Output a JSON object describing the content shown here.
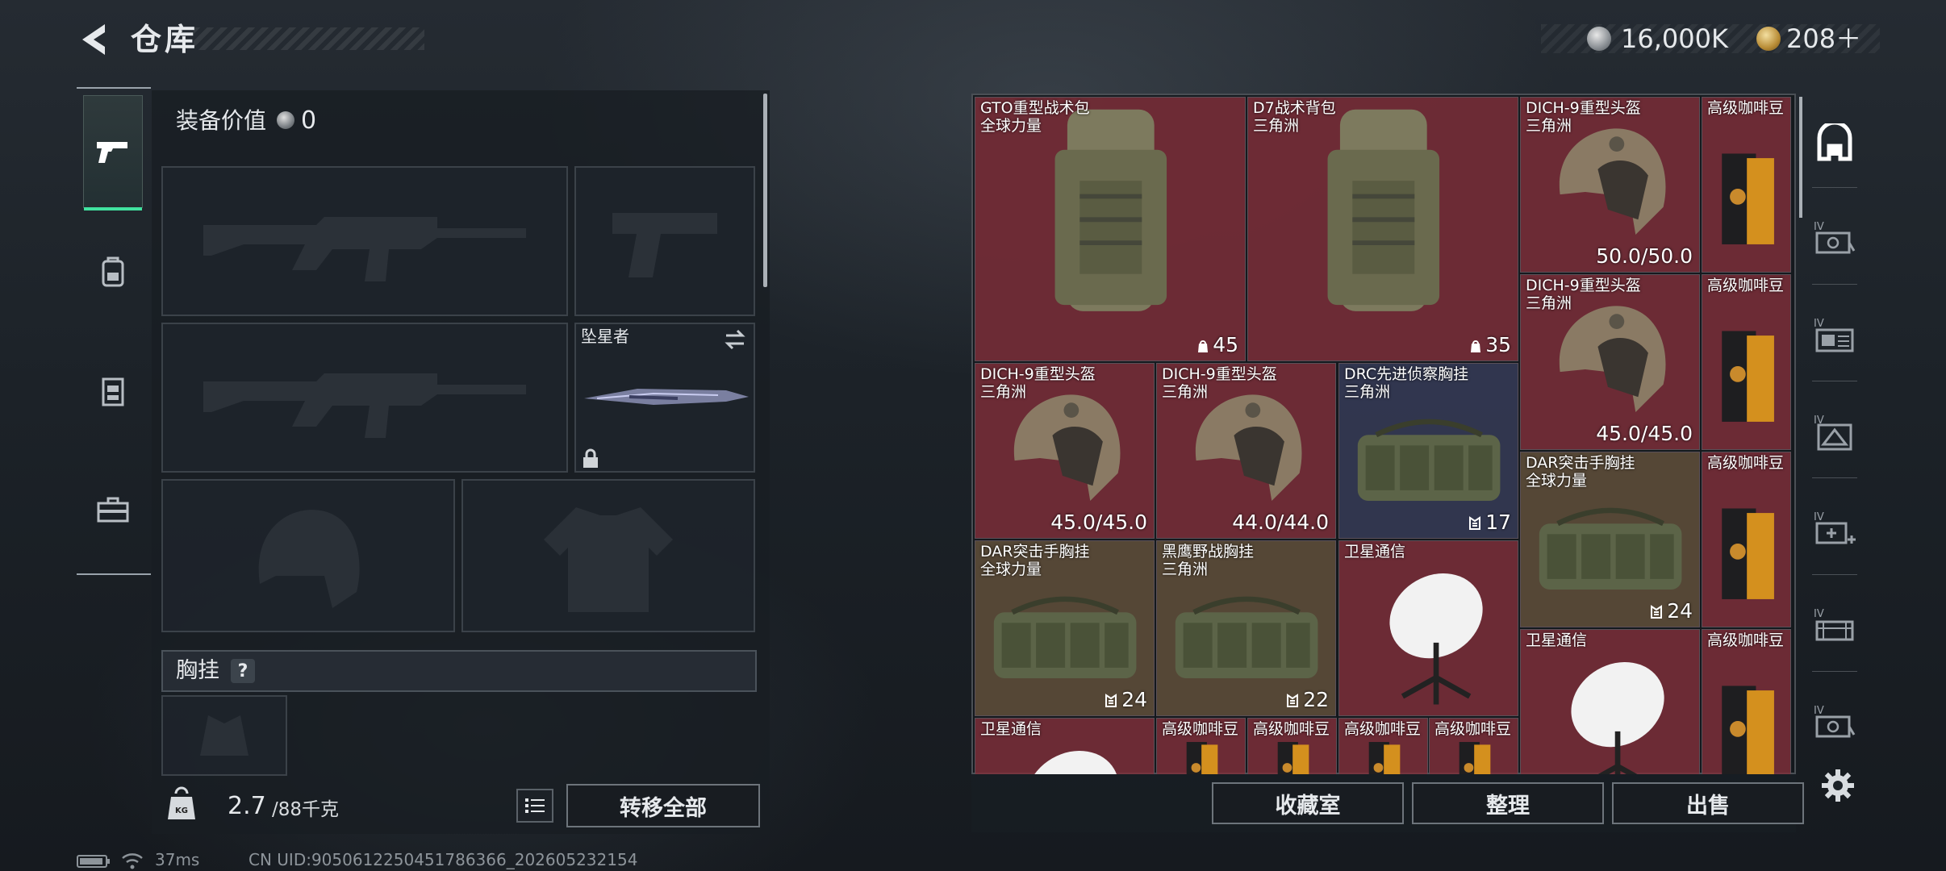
{
  "header": {
    "title": "仓库",
    "money": "16,000K",
    "premium": "208＋"
  },
  "equipment": {
    "value_label": "装备价值",
    "value": "0",
    "melee": {
      "name": "坠星者"
    },
    "rig": {
      "label": "胸挂",
      "help": "?"
    },
    "weight": {
      "current": "2.7",
      "capacity": "/88千克"
    },
    "transfer_all": "转移全部"
  },
  "status": {
    "ping": "37ms",
    "uid": "CN UID:9050612250451786366_202605232154"
  },
  "stash": {
    "items": [
      {
        "name": "GTO重型战术包",
        "sub": "全球力量",
        "stat": "45",
        "stat_icon": "capacity-icon",
        "rarity": "red",
        "kind": "backpack"
      },
      {
        "name": "D7战术背包",
        "sub": "三角洲",
        "stat": "35",
        "stat_icon": "capacity-icon",
        "rarity": "red",
        "kind": "backpack"
      },
      {
        "name": "DICH-9重型头盔",
        "sub": "三角洲",
        "stat": "50.0/50.0",
        "rarity": "red",
        "kind": "helmet"
      },
      {
        "name": "高级咖啡豆",
        "sub": "",
        "stat": "",
        "rarity": "red",
        "kind": "coffee"
      },
      {
        "name": "DICH-9重型头盔",
        "sub": "三角洲",
        "stat": "45.0/45.0",
        "rarity": "red",
        "kind": "helmet"
      },
      {
        "name": "高级咖啡豆",
        "sub": "",
        "stat": "",
        "rarity": "red",
        "kind": "coffee"
      },
      {
        "name": "DICH-9重型头盔",
        "sub": "三角洲",
        "stat": "45.0/45.0",
        "rarity": "red",
        "kind": "helmet"
      },
      {
        "name": "DICH-9重型头盔",
        "sub": "三角洲",
        "stat": "44.0/44.0",
        "rarity": "red",
        "kind": "helmet"
      },
      {
        "name": "DRC先进侦察胸挂",
        "sub": "三角洲",
        "stat": "17",
        "stat_icon": "rig-capacity-icon",
        "rarity": "blue",
        "kind": "rig"
      },
      {
        "name": "DAR突击手胸挂",
        "sub": "全球力量",
        "stat": "24",
        "stat_icon": "rig-capacity-icon",
        "rarity": "gold",
        "kind": "rig"
      },
      {
        "name": "高级咖啡豆",
        "sub": "",
        "stat": "",
        "rarity": "red",
        "kind": "coffee"
      },
      {
        "name": "DAR突击手胸挂",
        "sub": "全球力量",
        "stat": "24",
        "stat_icon": "rig-capacity-icon",
        "rarity": "gold",
        "kind": "rig"
      },
      {
        "name": "黑鹰野战胸挂",
        "sub": "三角洲",
        "stat": "22",
        "stat_icon": "rig-capacity-icon",
        "rarity": "gold",
        "kind": "rig"
      },
      {
        "name": "卫星通信",
        "sub": "",
        "stat": "",
        "rarity": "red",
        "kind": "satellite"
      },
      {
        "name": "卫星通信",
        "sub": "",
        "stat": "",
        "rarity": "red",
        "kind": "satellite"
      },
      {
        "name": "高级咖啡豆",
        "sub": "",
        "stat": "",
        "rarity": "red",
        "kind": "coffee"
      },
      {
        "name": "卫星通信",
        "sub": "",
        "stat": "",
        "rarity": "red",
        "kind": "satellite"
      },
      {
        "name": "高级咖啡豆",
        "sub": "",
        "stat": "",
        "rarity": "red",
        "kind": "coffee"
      },
      {
        "name": "高级咖啡豆",
        "sub": "",
        "stat": "",
        "rarity": "red",
        "kind": "coffee"
      },
      {
        "name": "高级咖啡豆",
        "sub": "",
        "stat": "",
        "rarity": "red",
        "kind": "coffee"
      },
      {
        "name": "高级咖啡豆",
        "sub": "",
        "stat": "",
        "rarity": "red",
        "kind": "coffee"
      }
    ],
    "buttons": {
      "collection": "收藏室",
      "sort": "整理",
      "sell": "出售"
    }
  },
  "icons": {
    "left_nav": [
      "pistol-icon",
      "backpack-icon",
      "rig-icon",
      "toolbox-icon"
    ],
    "right_nav": [
      "safehouse-icon",
      "iv-room-1-icon",
      "iv-room-2-icon",
      "iv-room-3-icon",
      "iv-room-add-icon",
      "iv-room-4-icon",
      "iv-room-5-icon"
    ]
  },
  "colors": {
    "accent": "#41e3a0",
    "rarity_red": "#80303a",
    "rarity_gold": "#5c4c3a",
    "rarity_blue": "#343a54"
  }
}
